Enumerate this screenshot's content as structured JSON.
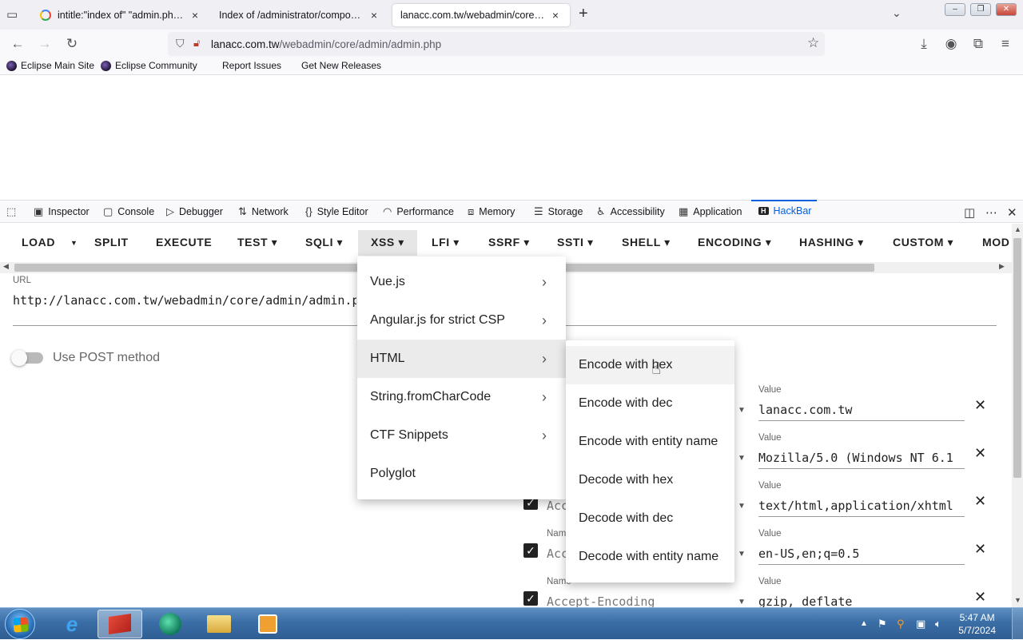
{
  "browser": {
    "tabs": [
      {
        "title": "intitle:\"index of\" \"admin.php\" -",
        "close": "×"
      },
      {
        "title": "Index of /administrator/component",
        "close": "×"
      },
      {
        "title": "lanacc.com.tw/webadmin/core/adm",
        "close": "×"
      }
    ],
    "new_tab": "+",
    "url_domain": "lanacc.com.tw",
    "url_path": "/webadmin/core/admin/admin.php",
    "bookmarks": [
      "Eclipse Main Site",
      "Eclipse Community",
      "Report Issues",
      "Get New Releases"
    ]
  },
  "devtools": {
    "tabs": [
      "Inspector",
      "Console",
      "Debugger",
      "Network",
      "Style Editor",
      "Performance",
      "Memory",
      "Storage",
      "Accessibility",
      "Application",
      "HackBar"
    ],
    "active_tab": "HackBar"
  },
  "hackbar": {
    "toolbar": [
      "LOAD",
      "SPLIT",
      "EXECUTE",
      "TEST ▾",
      "SQLI ▾",
      "XSS ▾",
      "LFI ▾",
      "SSRF ▾",
      "SSTI ▾",
      "SHELL ▾",
      "ENCODING ▾",
      "HASHING ▾",
      "CUSTOM ▾",
      "MOD"
    ],
    "active_menu": "XSS ▾",
    "url_label": "URL",
    "url_value": "http://lanacc.com.tw/webadmin/core/admin/admin.php",
    "post_label": "Use POST method",
    "headers": [
      {
        "name_label": "",
        "name": "",
        "value_label": "Value",
        "value": "lanacc.com.tw"
      },
      {
        "name_label": "",
        "name": "",
        "value_label": "Value",
        "value": "Mozilla/5.0 (Windows NT 6.1"
      },
      {
        "name_label": "",
        "name": "Acc",
        "value_label": "Value",
        "value": "text/html,application/xhtml"
      },
      {
        "name_label": "Nam",
        "name": "Acc",
        "value_label": "Value",
        "value": "en-US,en;q=0.5"
      },
      {
        "name_label": "Name",
        "name": "Accept-Encoding",
        "value_label": "Value",
        "value": "gzip, deflate"
      }
    ]
  },
  "xss_menu": {
    "items": [
      "Vue.js",
      "Angular.js for strict CSP",
      "HTML",
      "String.fromCharCode",
      "CTF Snippets",
      "Polyglot"
    ],
    "highlighted": "HTML"
  },
  "html_submenu": {
    "items": [
      "Encode with hex",
      "Encode with dec",
      "Encode with entity name",
      "Decode with hex",
      "Decode with dec",
      "Decode with entity name"
    ],
    "hovered": "Encode with hex"
  },
  "taskbar": {
    "time": "5:47 AM",
    "date": "5/7/2024"
  },
  "colors": {
    "accent": "#0060df",
    "taskbar": "#3b6ea6"
  }
}
